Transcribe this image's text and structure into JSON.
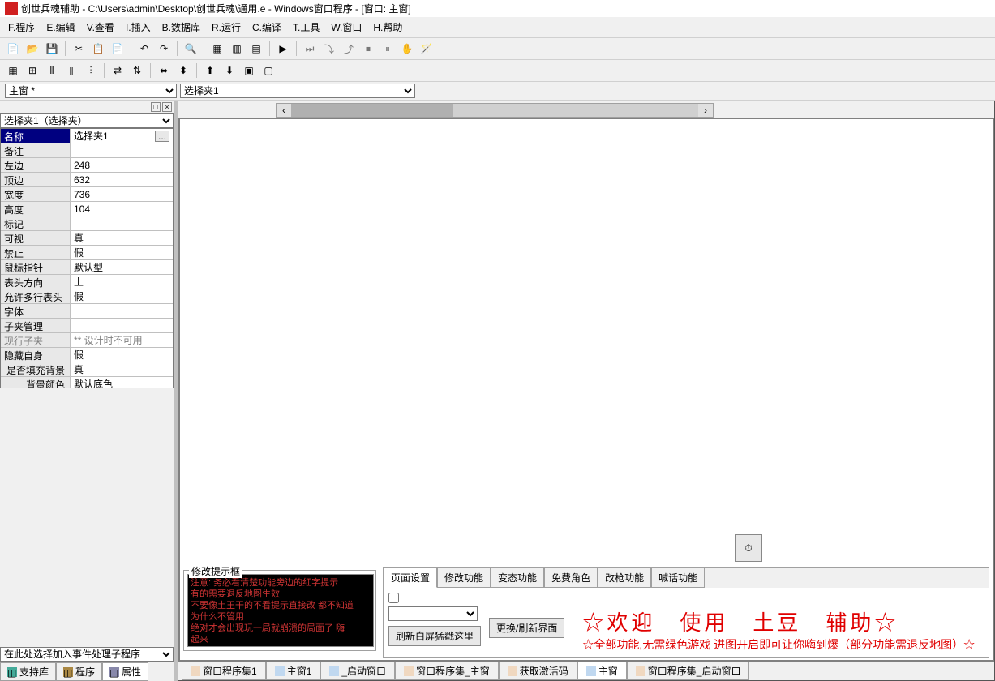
{
  "title": "创世兵魂辅助 - C:\\Users\\admin\\Desktop\\创世兵魂\\通用.e - Windows窗口程序 - [窗口: 主窗]",
  "menu": [
    "F.程序",
    "E.编辑",
    "V.查看",
    "I.插入",
    "B.数据库",
    "R.运行",
    "C.编译",
    "T.工具",
    "W.窗口",
    "H.帮助"
  ],
  "combo": {
    "left": "主窗 *",
    "right": "选择夹1"
  },
  "prop_selector": "选择夹1（选择夹）",
  "properties": [
    {
      "name": "名称",
      "value": "选择夹1",
      "selected": true,
      "hasBtn": true
    },
    {
      "name": "备注",
      "value": ""
    },
    {
      "name": "左边",
      "value": "248"
    },
    {
      "name": "顶边",
      "value": "632"
    },
    {
      "name": "宽度",
      "value": "736"
    },
    {
      "name": "高度",
      "value": "104"
    },
    {
      "name": "标记",
      "value": ""
    },
    {
      "name": "可视",
      "value": "真"
    },
    {
      "name": "禁止",
      "value": "假"
    },
    {
      "name": "鼠标指针",
      "value": "默认型"
    },
    {
      "name": "表头方向",
      "value": "上"
    },
    {
      "name": "允许多行表头",
      "value": "假"
    },
    {
      "name": "字体",
      "value": ""
    },
    {
      "name": "子夹管理",
      "value": ""
    },
    {
      "name": "现行子夹",
      "value": "**  设计时不可用",
      "disabled": true
    },
    {
      "name": "隐藏自身",
      "value": "假"
    },
    {
      "name": "是否填充背景",
      "value": "真",
      "sub": true
    },
    {
      "name": "背景颜色",
      "value": "默认底色",
      "sub": true
    }
  ],
  "event_selector": "在此处选择加入事件处理子程序",
  "left_tabs": [
    "支持库",
    "程序",
    "属性"
  ],
  "prompt": {
    "title": "修改提示框",
    "lines": [
      "注意: 务必看清楚功能旁边的红字提示",
      "有的需要退反地图生效",
      "不要像土王干的不看提示直接改 都不知道",
      "为什么不管用",
      "绝对才会出现玩一局就崩溃的局面了 嗨",
      "起来"
    ]
  },
  "tabs": [
    "页面设置",
    "修改功能",
    "变态功能",
    "免费角色",
    "改枪功能",
    "喊话功能"
  ],
  "buttons": {
    "refresh": "更换/刷新界面",
    "refresh2": "刷新白屏猛戳这里"
  },
  "welcome": "☆欢迎　使用　土豆　辅助☆",
  "notice": "☆全部功能,无需绿色游戏 进图开启即可让你嗨到爆（部分功能需退反地图）☆",
  "bottom_tabs": [
    "窗口程序集1",
    "主窗1",
    "_启动窗口",
    "窗口程序集_主窗",
    "获取激活码",
    "主窗",
    "窗口程序集_启动窗口"
  ]
}
